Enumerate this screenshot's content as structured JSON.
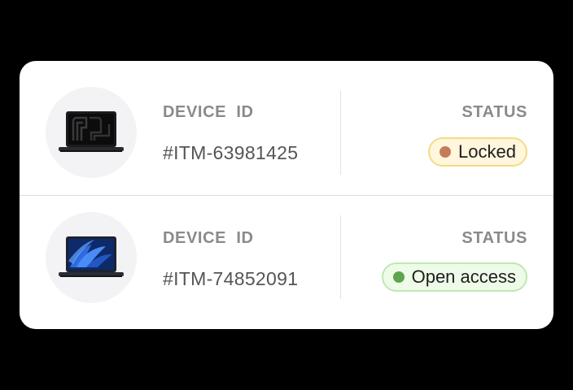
{
  "devices": [
    {
      "id_label": "DEVICE  ID",
      "id_value": "#ITM-63981425",
      "status_label": "STATUS",
      "status": "Locked",
      "status_color": "#c57b59",
      "image": "laptop-dark-wallpaper-icon"
    },
    {
      "id_label": "DEVICE  ID",
      "id_value": "#ITM-74852091",
      "status_label": "STATUS",
      "status": "Open access",
      "status_color": "#5da551",
      "image": "laptop-blue-wallpaper-icon"
    }
  ]
}
